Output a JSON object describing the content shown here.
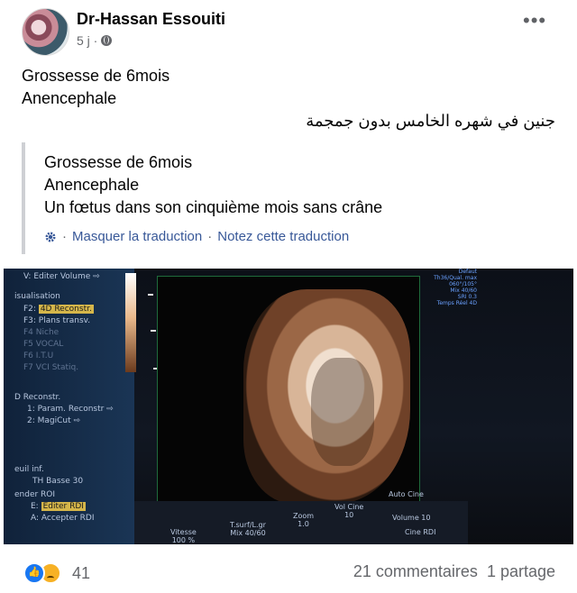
{
  "post": {
    "author": "Dr-Hassan Essouiti",
    "time": "5 j ·",
    "more_label": "•••",
    "lines": [
      "Grossesse  de 6mois",
      "Anencephale"
    ],
    "arabic_line": "جنين في شهره  الخامس بدون جمجمة"
  },
  "translation": {
    "lines": [
      "Grossesse  de 6mois",
      "Anencephale",
      "Un fœtus dans son cinquième mois sans crâne"
    ],
    "hide_label": "Masquer la traduction",
    "separator": "·",
    "rate_label": "Notez cette traduction"
  },
  "ultrasound": {
    "menu_header": "V:  Editer Volume ⇨",
    "visualisation": "isualisation",
    "f2": "F2:",
    "f2_value": "4D Reconstr.",
    "f3": "F3:  Plans transv.",
    "f4": "F4  Niche",
    "f5": "F5  VOCAL",
    "f6": "F6  I.T.U",
    "f7": "F7  VCI Statiq.",
    "d_reconstr": "D Reconstr.",
    "param": "1:  Param. Reconstr ⇨",
    "magicut": "2:  MagiCut ⇨",
    "seuil": "euil inf.",
    "th_basse": "TH Basse   30",
    "render_roi": "ender ROI",
    "editer_key": "E:",
    "editer_roi": "Editer RDI",
    "accepter": "A:  Accepter RDI",
    "r_defaut": "Defaut",
    "r_line2": "Th36/Qual. max",
    "r_line3": "060°/105°",
    "r_line4": "Mix 40/60",
    "r_line5": "SRI 0.3",
    "r_line6": "Temps Réel 4D",
    "b_vitesse": "Vitesse",
    "b_vitesse_val": "100 %",
    "b_tsurf": "T.surf/L.gr",
    "b_mix": "Mix 40/60",
    "b_zoom": "Zoom",
    "b_zoom_val": "1.0",
    "b_volcine": "Vol Cine",
    "b_volcine_val": "10",
    "b_autocine": "Auto Cine",
    "b_volume": "Volume 10",
    "b_cinerdi": "Cine RDI"
  },
  "footer": {
    "reaction_count": "41",
    "comments": "21 commentaires",
    "shares": "1 partage"
  }
}
